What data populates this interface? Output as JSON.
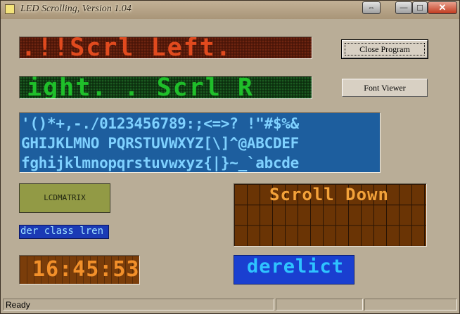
{
  "window": {
    "title": "LED Scrolling, Version 1.04",
    "icon": "app-icon",
    "controls": {
      "swap_label": "⇔",
      "minimize_label": "—",
      "maximize_label": "☐",
      "close_label": "✕"
    }
  },
  "buttons": {
    "close_program": "Close Program",
    "font_viewer": "Font Viewer"
  },
  "displays": {
    "red_scroll_text": ".!!Scrl Left.",
    "green_scroll_text": "ight. . Scrl R",
    "blue_matrix_lines": [
      "'()*+,-./0123456789:;<=>? !\"#$%&",
      "GHIJKLMNO PQRSTUVWXYZ[\\]^@ABCDEF",
      "fghijklmnopqrstuvwxyz{|}~_`abcde"
    ],
    "lcd_text": "LCDMATRIX",
    "small_scroll_text": "der class lren",
    "clock_text": "16:45:53",
    "scroll_down_text": "Scroll Down",
    "derelict_text": "derelict"
  },
  "statusbar": {
    "text": "Ready"
  },
  "colors": {
    "led_red": "#e14a1e",
    "led_green": "#1fbf2a",
    "matrix_blue": "#7fd1ff",
    "clock_orange": "#f2902a"
  }
}
